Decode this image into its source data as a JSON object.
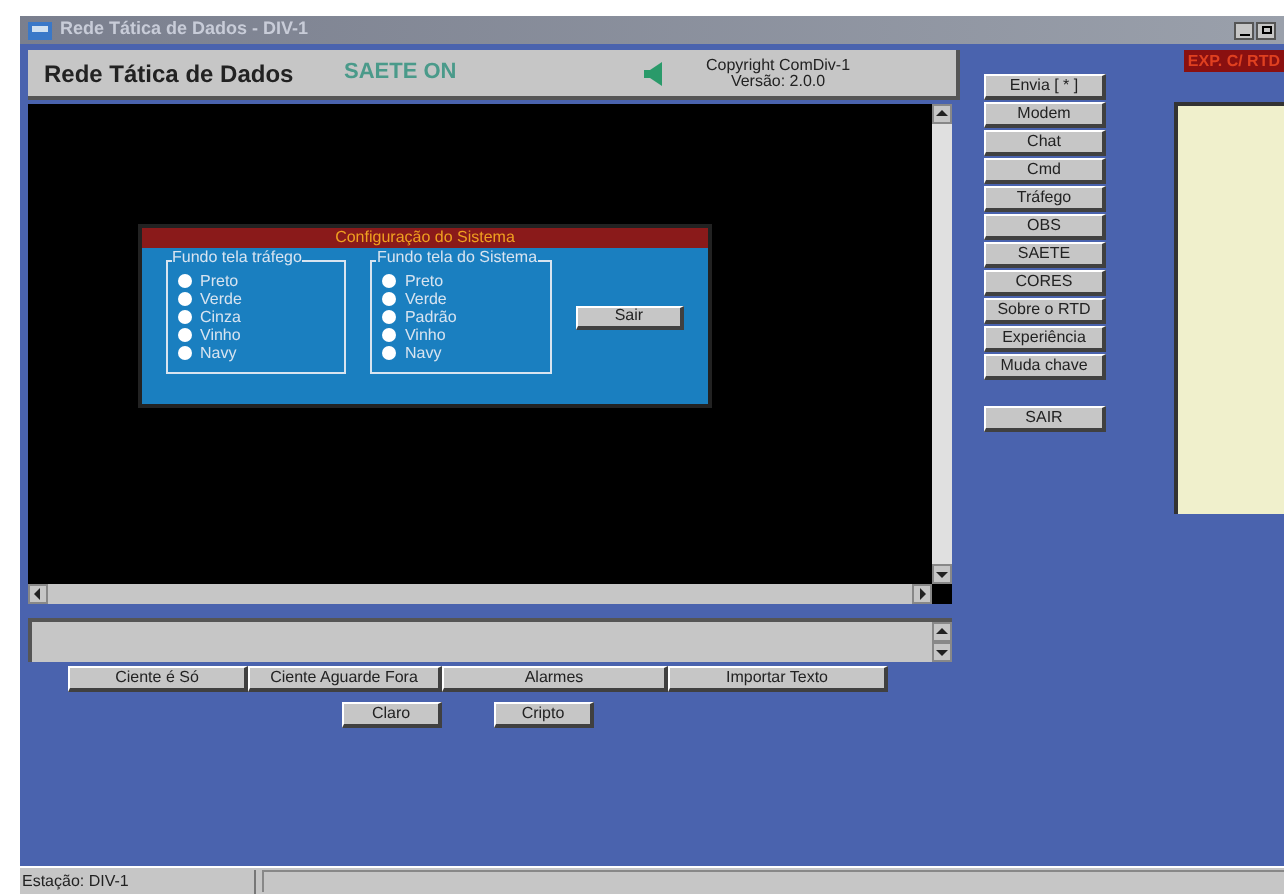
{
  "window": {
    "title": "Rede Tática de Dados - DIV-1"
  },
  "header": {
    "title": "Rede Tática de Dados",
    "status": "SAETE ON",
    "copyright": "Copyright ComDiv-1",
    "version": "Versão:  2.0.0"
  },
  "dialog": {
    "title": "Configuração do Sistema",
    "groups": [
      {
        "label": "Fundo tela tráfego",
        "options": [
          {
            "label": "Preto",
            "selected": false
          },
          {
            "label": "Verde",
            "selected": false
          },
          {
            "label": "Cinza",
            "selected": false
          },
          {
            "label": "Vinho",
            "selected": false
          },
          {
            "label": "Navy",
            "selected": false
          }
        ]
      },
      {
        "label": "Fundo tela do Sistema",
        "options": [
          {
            "label": "Preto",
            "selected": false
          },
          {
            "label": "Verde",
            "selected": false
          },
          {
            "label": "Padrão",
            "selected": false
          },
          {
            "label": "Vinho",
            "selected": false
          },
          {
            "label": "Navy",
            "selected": false
          }
        ]
      }
    ],
    "button": "Sair"
  },
  "bottom_buttons": [
    "Ciente é Só",
    "Ciente Aguarde Fora",
    "Alarmes",
    "Importar Texto"
  ],
  "bottom_buttons_2": [
    "Claro",
    "Cripto"
  ],
  "side_buttons": [
    "Envia [ * ]",
    "Modem",
    "Chat",
    "Cmd",
    "Tráfego",
    "OBS",
    "SAETE",
    "CORES",
    "Sobre o RTD",
    "Experiência",
    "Muda chave"
  ],
  "exit_button": "SAIR",
  "mode_label": "EXP. C/ RTD",
  "status_bar": {
    "station": "Estação: DIV-1"
  }
}
